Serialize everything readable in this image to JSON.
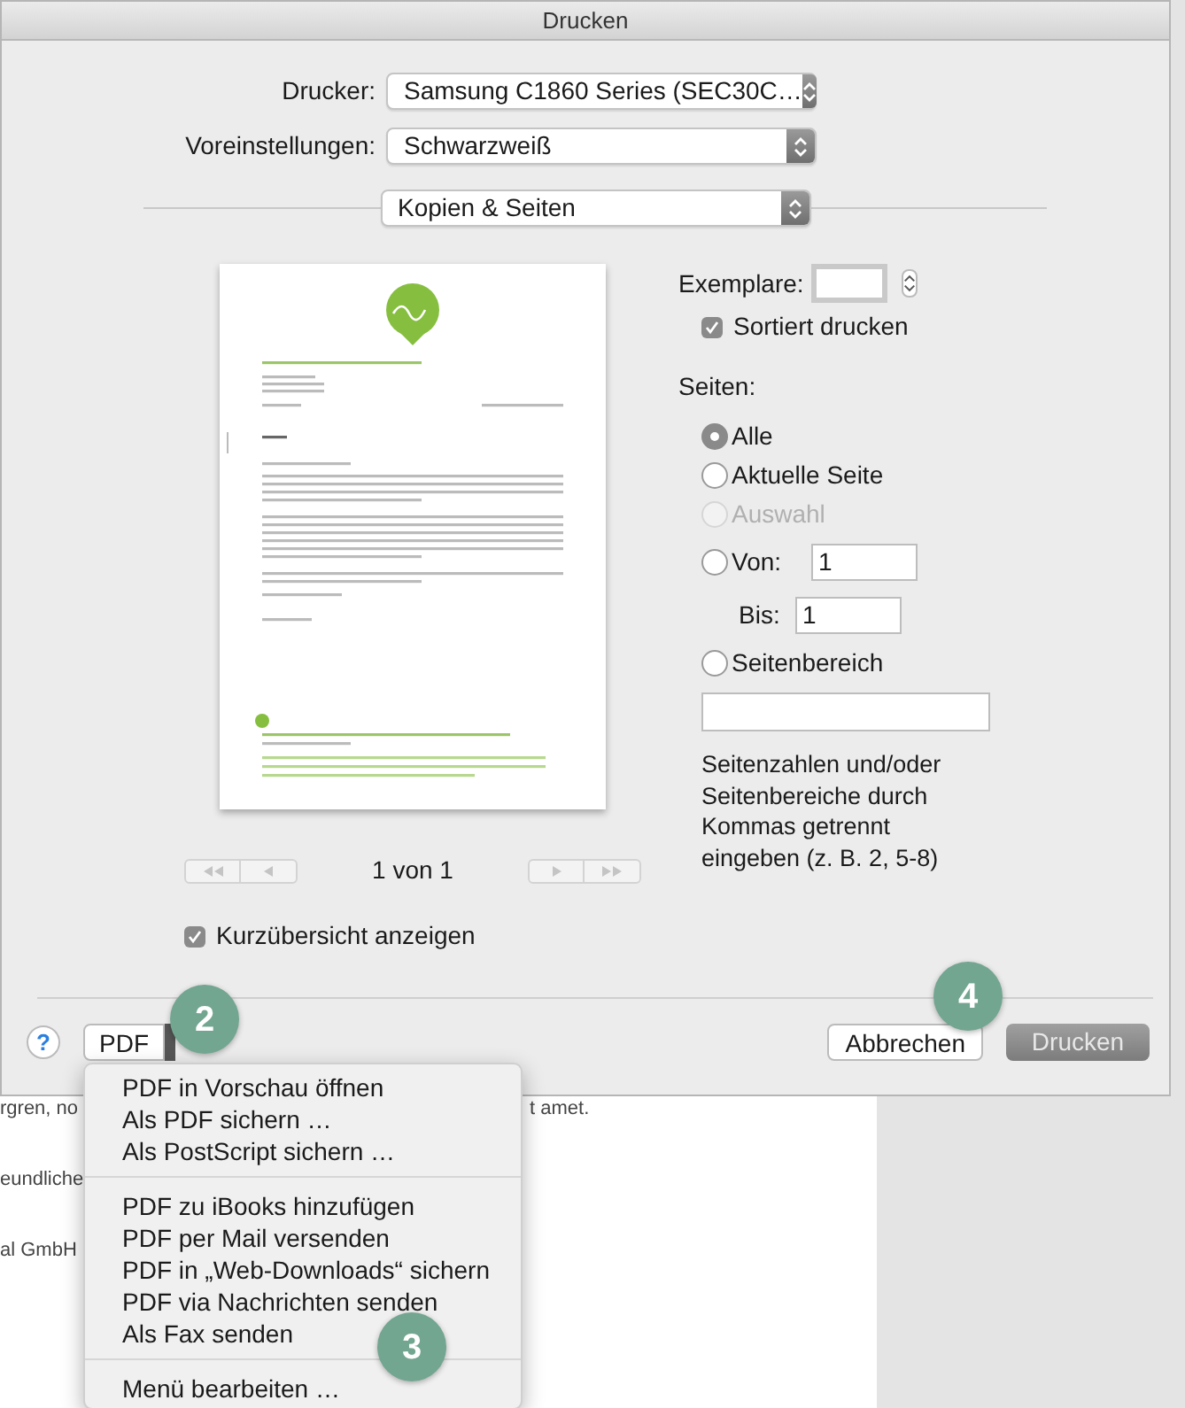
{
  "window": {
    "title": "Drucken"
  },
  "printer": {
    "label": "Drucker:",
    "value": "Samsung C1860 Series (SEC30C…"
  },
  "presets": {
    "label": "Voreinstellungen:",
    "value": "Schwarzweiß"
  },
  "section_menu": {
    "value": "Kopien & Seiten"
  },
  "page_indicator": "1 von 1",
  "show_preview": {
    "label": "Kurzübersicht anzeigen",
    "checked": true
  },
  "copies": {
    "label": "Exemplare:"
  },
  "collate": {
    "label": "Sortiert drucken",
    "checked": true
  },
  "pages": {
    "label": "Seiten:",
    "options": [
      {
        "kind": "plain",
        "label": "Alle",
        "selected": true,
        "disabled": false
      },
      {
        "kind": "plain",
        "label": "Aktuelle Seite",
        "selected": false,
        "disabled": false
      },
      {
        "kind": "plain",
        "label": "Auswahl",
        "selected": false,
        "disabled": true
      },
      {
        "kind": "from",
        "label": "Von:",
        "value": "1",
        "selected": false,
        "disabled": false
      },
      {
        "kind": "to",
        "label": "Bis:",
        "value": "1"
      },
      {
        "kind": "range",
        "label": "Seitenbereich",
        "selected": false,
        "disabled": false
      }
    ],
    "hint": "Seitenzahlen und/oder Seitenbereiche durch Kommas getrennt eingeben (z. B. 2, 5-8)"
  },
  "footer": {
    "help": "?",
    "pdf": "PDF",
    "cancel": "Abbrechen",
    "print": "Drucken"
  },
  "pdf_menu": [
    [
      "PDF in Vorschau öffnen",
      "Als PDF sichern …",
      "Als PostScript sichern …"
    ],
    [
      "PDF zu iBooks hinzufügen",
      "PDF per Mail versenden",
      "PDF in „Web-Downloads“ sichern",
      "PDF via Nachrichten senden",
      "Als Fax senden"
    ],
    [
      "Menü bearbeiten …"
    ]
  ],
  "callouts": [
    "2",
    "4",
    "3"
  ],
  "background_text": [
    "rgren, no",
    "t amet.",
    "eundliche",
    "al GmbH"
  ]
}
